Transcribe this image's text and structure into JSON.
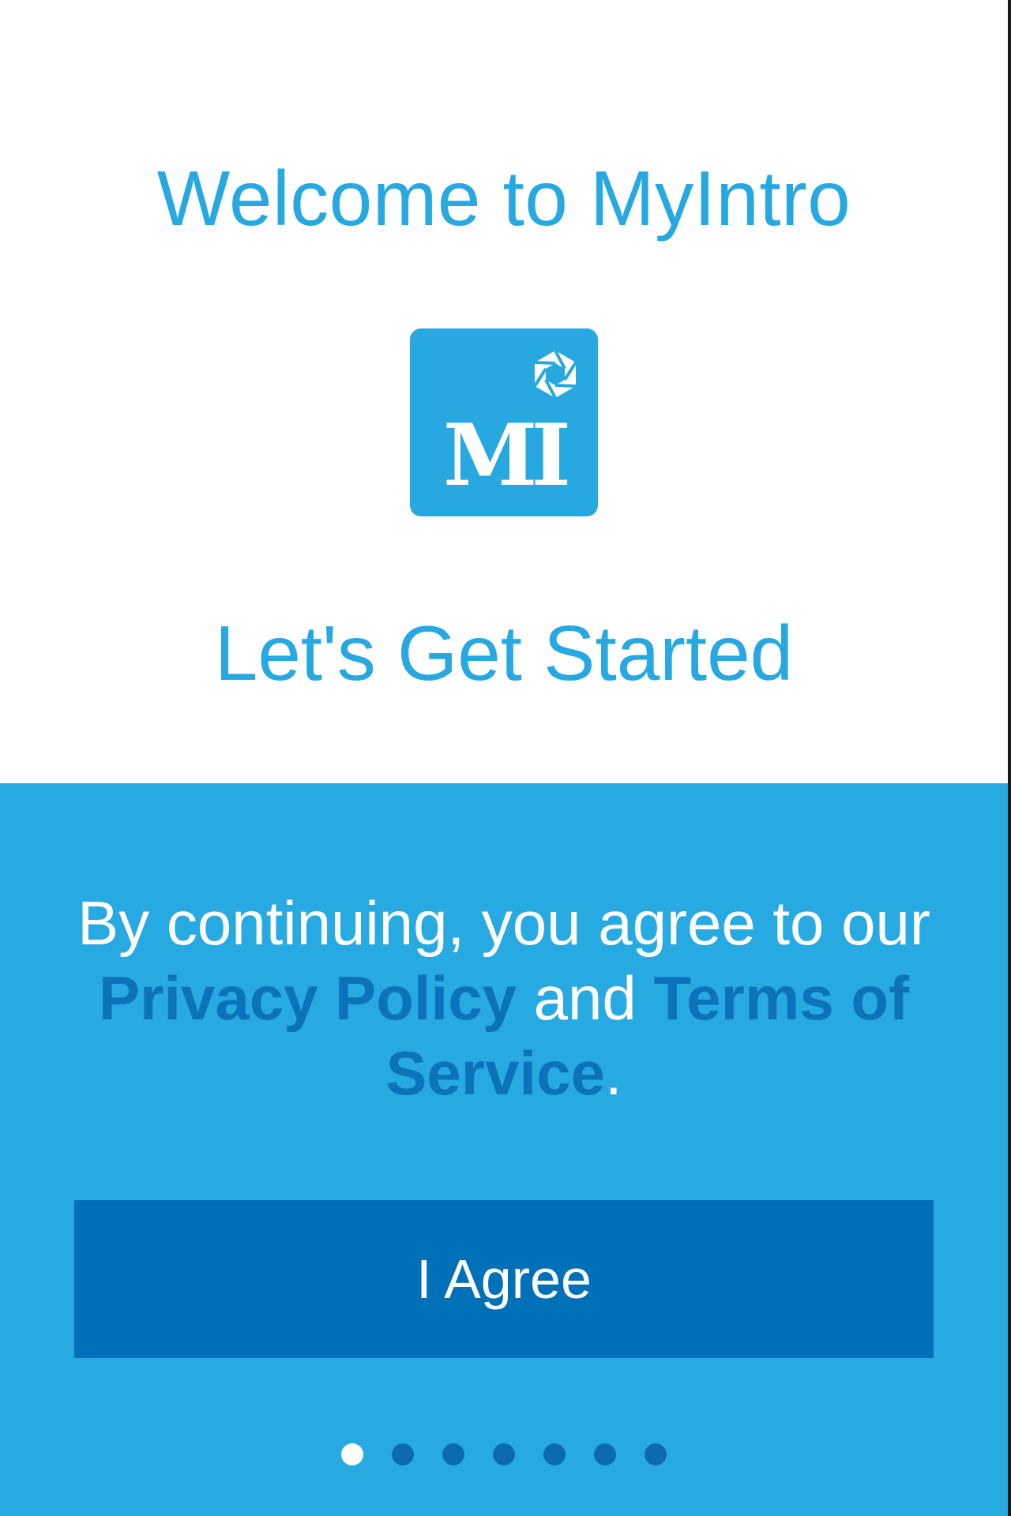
{
  "header": {
    "title": "Welcome to MyIntro",
    "subtitle": "Let's Get Started"
  },
  "logo": {
    "text": "MI",
    "icon": "aperture-icon"
  },
  "consent": {
    "prefix": "By continuing, you agree to our ",
    "privacy_link": "Privacy Policy",
    "middle": " and ",
    "terms_link": "Terms of Service",
    "suffix": "."
  },
  "agree_button": {
    "label": "I Agree"
  },
  "pagination": {
    "total": 7,
    "current": 1
  },
  "colors": {
    "primary": "#27aae1",
    "button": "#0070b8",
    "link": "#0c72b9"
  }
}
